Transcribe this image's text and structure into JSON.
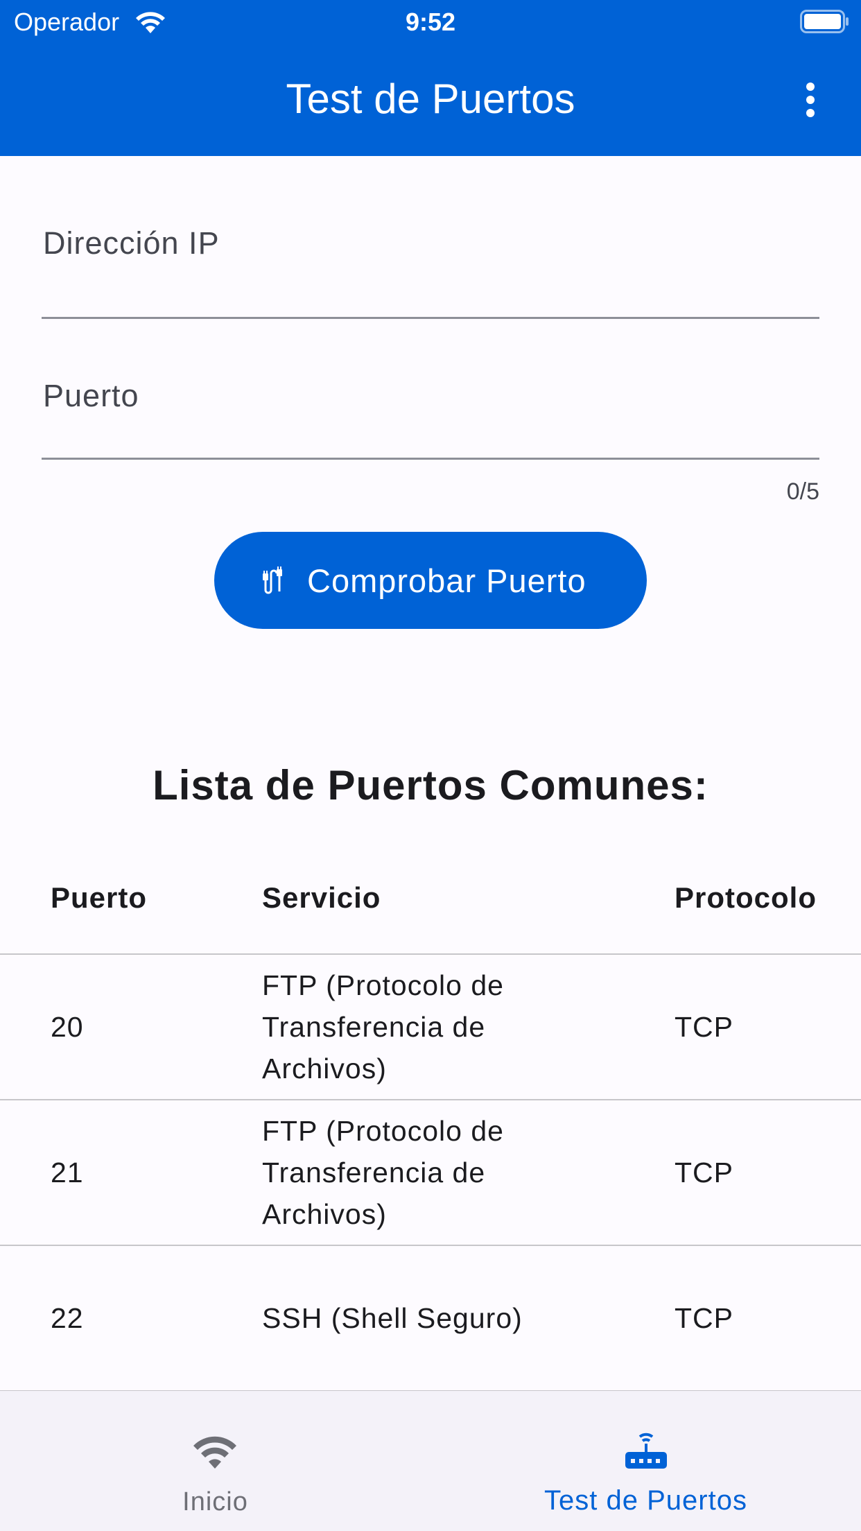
{
  "status_bar": {
    "carrier": "Operador",
    "time": "9:52"
  },
  "app_bar": {
    "title": "Test de Puertos"
  },
  "form": {
    "ip_label": "Dirección IP",
    "ip_value": "",
    "port_label": "Puerto",
    "port_value": "",
    "port_counter": "0/5"
  },
  "check_button": {
    "label": "Comprobar Puerto"
  },
  "section": {
    "title": "Lista de Puertos Comunes:"
  },
  "table": {
    "headers": {
      "port": "Puerto",
      "service": "Servicio",
      "protocol": "Protocolo"
    },
    "rows": [
      {
        "port": "20",
        "service": "FTP (Protocolo de Transferencia de Archivos)",
        "protocol": "TCP"
      },
      {
        "port": "21",
        "service": "FTP (Protocolo de Transferencia de Archivos)",
        "protocol": "TCP"
      },
      {
        "port": "22",
        "service": "SSH (Shell Seguro)",
        "protocol": "TCP"
      }
    ]
  },
  "bottom_nav": {
    "items": [
      {
        "label": "Inicio",
        "icon": "wifi-icon",
        "active": false
      },
      {
        "label": "Test de Puertos",
        "icon": "router-icon",
        "active": true
      }
    ]
  },
  "colors": {
    "primary": "#0062d6",
    "background": "#fdfbff",
    "nav_background": "#f4f2f9",
    "inactive": "#6e6f76"
  }
}
